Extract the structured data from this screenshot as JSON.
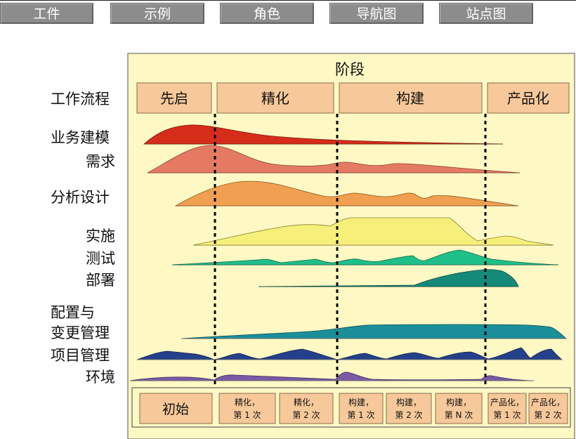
{
  "nav": [
    {
      "label": "工件"
    },
    {
      "label": "示例"
    },
    {
      "label": "角色"
    },
    {
      "label": "导航图"
    },
    {
      "label": "站点图"
    }
  ],
  "diagram": {
    "title": "阶段",
    "workflow_label": "工作流程",
    "phases": [
      {
        "label": "先启"
      },
      {
        "label": "精化"
      },
      {
        "label": "构建"
      },
      {
        "label": "产品化"
      }
    ],
    "disciplines": [
      {
        "label": "业务建模"
      },
      {
        "label": "需求"
      },
      {
        "label": "分析设计"
      },
      {
        "label": "实施"
      },
      {
        "label": "测试"
      },
      {
        "label": "部署"
      },
      {
        "label": "配置与"
      },
      {
        "label": "变更管理"
      },
      {
        "label": "项目管理"
      },
      {
        "label": "环境"
      }
    ],
    "iterations": [
      {
        "line1": "初始",
        "line2": ""
      },
      {
        "line1": "精化，",
        "line2": "第 1 次"
      },
      {
        "line1": "精化，",
        "line2": "第 2 次"
      },
      {
        "line1": "构建，",
        "line2": "第 1 次"
      },
      {
        "line1": "构建，",
        "line2": "第 2 次"
      },
      {
        "line1": "构建，",
        "line2": "第 N 次"
      },
      {
        "line1": "产品化，",
        "line2": "第 1 次"
      },
      {
        "line1": "产品化，",
        "line2": "第 2 次"
      }
    ],
    "colors": {
      "background": "#fdf8c4",
      "box_fill": "#f6c89a",
      "business_modeling": "#d62c1a",
      "requirements": "#e57a63",
      "analysis_design": "#f0a050",
      "implementation": "#f6ef7a",
      "test": "#1fbf8a",
      "deployment": "#168a7a",
      "config_change": "#1a8f9a",
      "project_management": "#24408a",
      "environment": "#7a59a6"
    }
  }
}
